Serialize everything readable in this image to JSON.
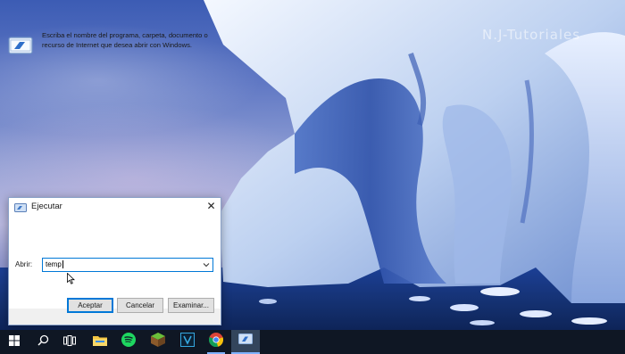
{
  "wallpaper": {
    "watermark": "N.J-Tutoriales"
  },
  "run_dialog": {
    "title": "Ejecutar",
    "description": "Escriba el nombre del programa, carpeta, documento o recurso de Internet que desea abrir con Windows.",
    "open_label": "Abrir:",
    "input_value": "temp",
    "buttons": {
      "ok": "Aceptar",
      "cancel": "Cancelar",
      "browse": "Examinar..."
    },
    "close_glyph": "✕"
  },
  "taskbar": {
    "items": [
      {
        "name": "start-button",
        "icon": "windows-icon"
      },
      {
        "name": "search-button",
        "icon": "search-icon"
      },
      {
        "name": "task-view-button",
        "icon": "task-view-icon"
      },
      {
        "name": "file-explorer",
        "icon": "folder-icon"
      },
      {
        "name": "spotify",
        "icon": "spotify-icon"
      },
      {
        "name": "minecraft",
        "icon": "minecraft-icon"
      },
      {
        "name": "vegas",
        "icon": "v-app-icon"
      },
      {
        "name": "chrome",
        "icon": "chrome-icon"
      },
      {
        "name": "run-app",
        "icon": "run-icon"
      }
    ],
    "accent": "#7fb2ff"
  },
  "colors": {
    "focus_border": "#0078d7",
    "taskbar_bg": "#0f1724"
  }
}
